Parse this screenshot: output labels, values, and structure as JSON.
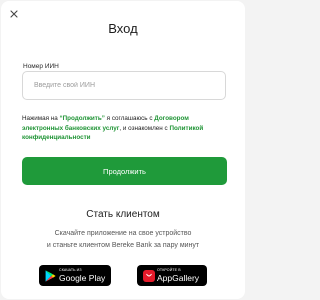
{
  "modal": {
    "title": "Вход",
    "close_icon": "close-icon"
  },
  "iin_field": {
    "label": "Номер ИИН",
    "value": "",
    "placeholder": "Введите свой ИИН"
  },
  "consent": {
    "part1": "Нажимая на ",
    "button_ref": "“Продолжить”",
    "part2": " я соглашаюсь с ",
    "terms_link": "Договором электронных банковских услуг",
    "part3": ", и ознакомлен с ",
    "privacy_link": "Политикой конфиденциальности"
  },
  "continue_button": {
    "label": "Продолжить"
  },
  "become_client": {
    "title": "Стать клиентом",
    "desc_line1": "Скачайте приложение на свое устройство",
    "desc_line2": "и станьте клиентом Bereke Bank за пару минут"
  },
  "store_badges": {
    "google_play": {
      "small": "СКАЧАТЬ ИЗ",
      "big": "Google Play",
      "icon": "google-play-icon"
    },
    "app_gallery": {
      "small": "ОТКРОЙТЕ В",
      "big": "AppGallery",
      "icon": "huawei-appgallery-icon"
    }
  },
  "colors": {
    "accent": "#1f9a3a",
    "link": "#1f9435",
    "background": "#f3f3f3",
    "card": "#ffffff"
  }
}
